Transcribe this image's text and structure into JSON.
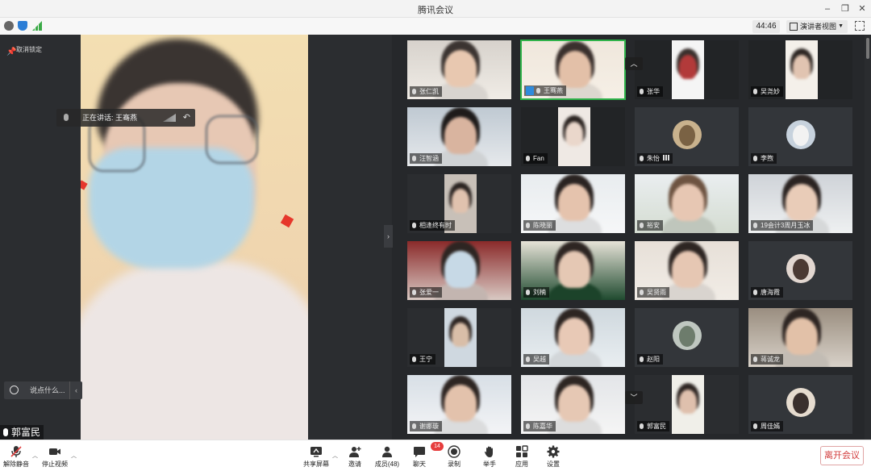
{
  "window": {
    "title": "腾讯会议",
    "timer": "44:46",
    "view_mode": "演讲者视图"
  },
  "speaker": {
    "unpin_label": "取消锁定",
    "speaking_label": "正在讲话: 王骞燕",
    "chat_placeholder": "说点什么...",
    "self_name": "郭富民"
  },
  "participants": [
    {
      "name": "张仁凯"
    },
    {
      "name": "王骞燕",
      "host": true,
      "active": true
    },
    {
      "name": "张华"
    },
    {
      "name": "吴尧妙"
    },
    {
      "name": "汪智涵"
    },
    {
      "name": "Fan"
    },
    {
      "name": "朱怡",
      "signal": true
    },
    {
      "name": "李煦"
    },
    {
      "name": "相逢终有时"
    },
    {
      "name": "陈晓丽"
    },
    {
      "name": "裕安"
    },
    {
      "name": "19会计3周月玉冰"
    },
    {
      "name": "张爱一"
    },
    {
      "name": "刘楠"
    },
    {
      "name": "吴贤雨"
    },
    {
      "name": "唐海霞"
    },
    {
      "name": "王宁"
    },
    {
      "name": "吴越"
    },
    {
      "name": "赵阳"
    },
    {
      "name": "蒋诚龙"
    },
    {
      "name": "谢娜璇"
    },
    {
      "name": "陈嘉华"
    },
    {
      "name": "郭富民"
    },
    {
      "name": "周佳嫣"
    }
  ],
  "toolbar": {
    "unmute": "解除静音",
    "stop_video": "停止视频",
    "share_screen": "共享屏幕",
    "invite": "邀请",
    "members": "成员(48)",
    "chat": "聊天",
    "chat_badge": "14",
    "record": "录制",
    "raise_hand": "举手",
    "apps": "应用",
    "settings": "设置",
    "leave": "离开会议"
  },
  "colors": {
    "active_border": "#2fb34a",
    "leave_text": "#d23c3c",
    "badge": "#e63d3d"
  }
}
